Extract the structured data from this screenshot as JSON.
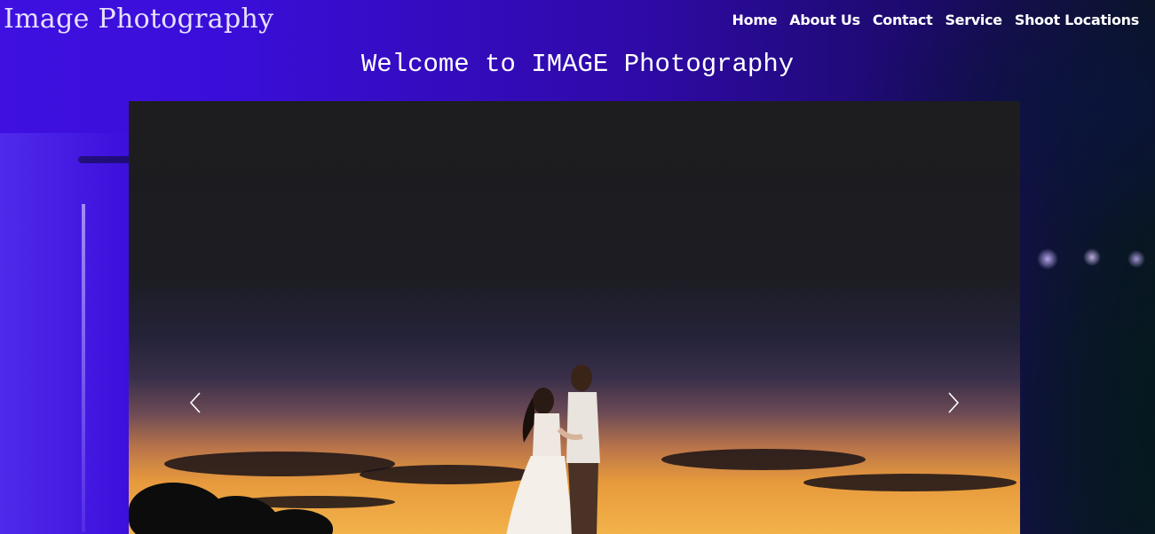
{
  "header": {
    "site_title": "Image Photography",
    "nav": [
      "Home",
      "About Us",
      "Contact",
      "Service",
      "Shoot Locations"
    ]
  },
  "main": {
    "welcome_heading": "Welcome to IMAGE Photography"
  },
  "carousel": {
    "prev_icon": "chevron-left-icon",
    "next_icon": "chevron-right-icon",
    "image_subject": "couple-at-sunset"
  },
  "colors": {
    "background_accent": "#3a0ed8",
    "text": "#ffffff"
  }
}
